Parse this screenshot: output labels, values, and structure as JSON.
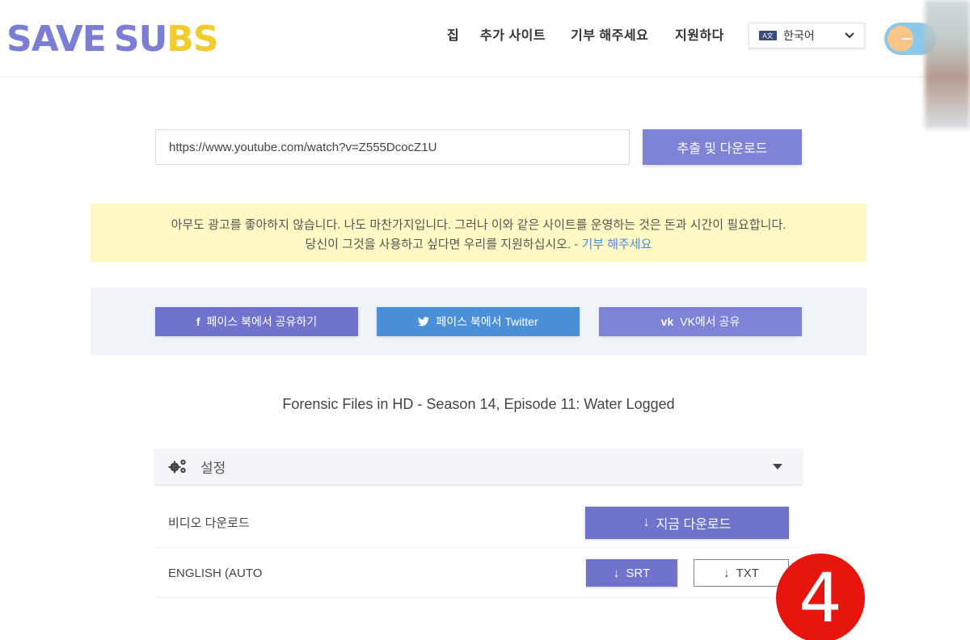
{
  "header": {
    "logo_part1": "SAVE",
    "logo_part2": "SU",
    "logo_part3": "BS",
    "nav": [
      "집",
      "추가 사이트",
      "기부 해주세요",
      "지원하다"
    ],
    "language": {
      "flag_text": "A文",
      "selected": "한국어"
    }
  },
  "search": {
    "url_value": "https://www.youtube.com/watch?v=Z555DcocZ1U",
    "button_label": "추출 및 다운로드"
  },
  "notice": {
    "line1": "아무도 광고를 좋아하지 않습니다. 나도 마찬가지입니다. 그러나 이와 같은 사이트를 운영하는 것은 돈과 시간이 필요합니다.",
    "line2": "당신이 그것을 사용하고 싶다면 우리를 지원하십시오.  -",
    "link": "기부 해주세요"
  },
  "share": {
    "facebook_icon": "f",
    "facebook": "페이스 북에서 공유하기",
    "twitter_icon": "🐦",
    "twitter": "페이스 북에서 Twitter",
    "vk_icon": "vk",
    "vk": "VK에서 공유"
  },
  "video": {
    "title": "Forensic Files in HD - Season 14, Episode 11: Water Logged"
  },
  "settings": {
    "label": "설정"
  },
  "downloads": {
    "video_label": "비디오 다운로드",
    "video_button": "지금 다운로드",
    "subtitle_label": "ENGLISH (AUTO",
    "srt_button": "SRT",
    "txt_button": "TXT"
  },
  "badge": {
    "number": "4"
  },
  "colors": {
    "accent": "#7f83d8",
    "brand_blue": "#7b7ed4",
    "brand_yellow": "#f2cc2e",
    "twitter": "#4a90d9",
    "badge_red": "#e8140e",
    "notice_bg": "#fff9c4"
  }
}
